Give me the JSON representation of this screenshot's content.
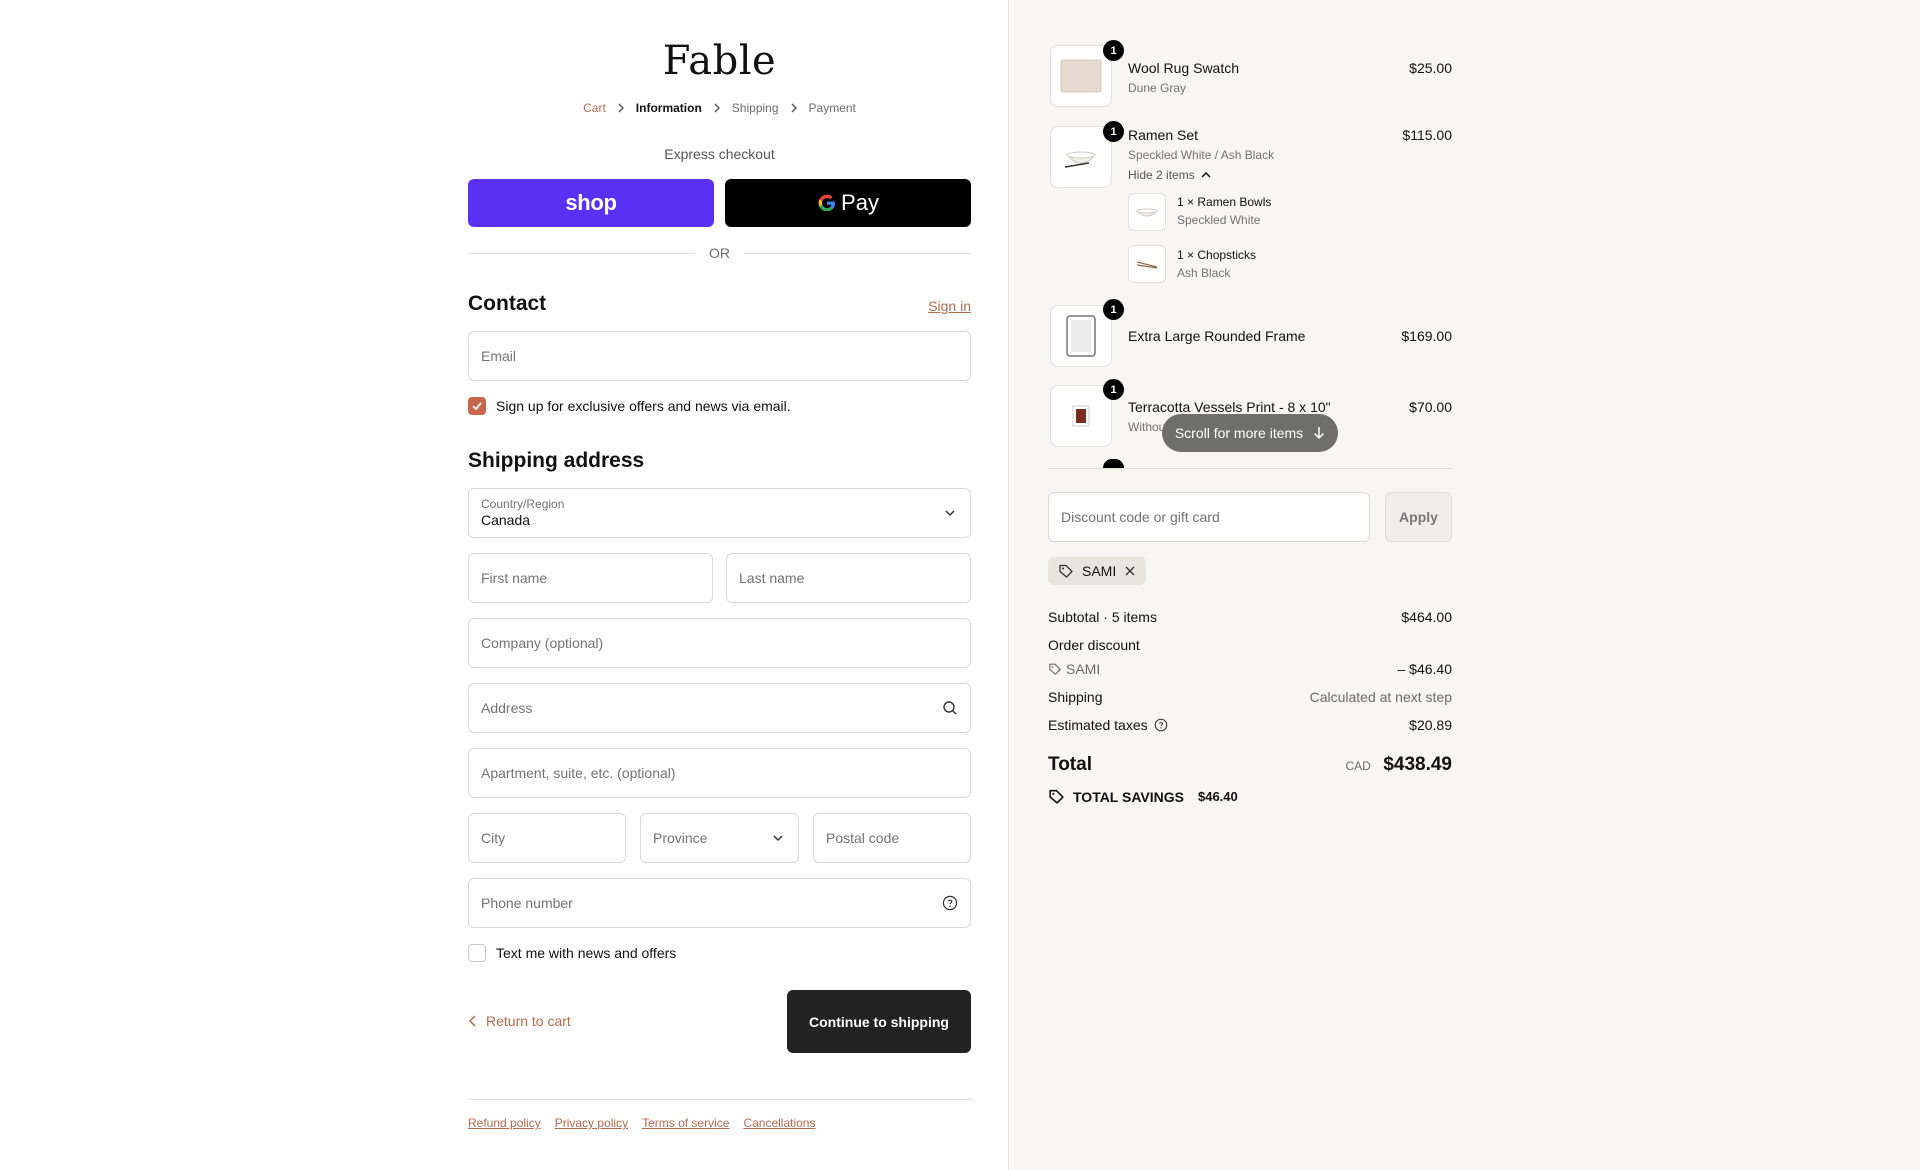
{
  "brand": {
    "logo": "Fable"
  },
  "breadcrumbs": [
    {
      "label": "Cart",
      "state": "link"
    },
    {
      "label": "Information",
      "state": "active"
    },
    {
      "label": "Shipping",
      "state": "pending"
    },
    {
      "label": "Payment",
      "state": "pending"
    }
  ],
  "express": {
    "label": "Express checkout",
    "shop_label": "shop",
    "gpay_label": "Pay",
    "or_label": "OR"
  },
  "contact": {
    "title": "Contact",
    "sign_in": "Sign in",
    "email_placeholder": "Email",
    "newsletter_label": "Sign up for exclusive offers and news via email.",
    "newsletter_checked": true
  },
  "shipping": {
    "title": "Shipping address",
    "country_label": "Country/Region",
    "country_value": "Canada",
    "first_name": "First name",
    "last_name": "Last name",
    "company": "Company (optional)",
    "address": "Address",
    "apartment": "Apartment, suite, etc. (optional)",
    "city": "City",
    "province": "Province",
    "postal": "Postal code",
    "phone": "Phone number",
    "sms_label": "Text me with news and offers",
    "sms_checked": false
  },
  "actions": {
    "return_label": "Return to cart",
    "continue_label": "Continue to shipping"
  },
  "footer": {
    "links": [
      "Refund policy",
      "Privacy policy",
      "Terms of service",
      "Cancellations"
    ]
  },
  "cart": {
    "items": [
      {
        "name": "Wool Rug Swatch",
        "variant": "Dune Gray",
        "price": "$25.00",
        "qty": "1"
      },
      {
        "name": "Ramen Set",
        "variant": "Speckled White / Ash Black",
        "price": "$115.00",
        "qty": "1",
        "toggle": "Hide 2 items",
        "sub": [
          {
            "name": "1 × Ramen Bowls",
            "variant": "Speckled White"
          },
          {
            "name": "1 × Chopsticks",
            "variant": "Ash Black"
          }
        ]
      },
      {
        "name": "Extra Large Rounded Frame",
        "variant": "",
        "price": "$169.00",
        "qty": "1"
      },
      {
        "name": "Terracotta Vessels Print - 8 x 10\"",
        "variant": "Withou",
        "price": "$70.00",
        "qty": "1"
      }
    ],
    "scroll_hint": "Scroll for more items"
  },
  "discount": {
    "placeholder": "Discount code or gift card",
    "apply_label": "Apply",
    "applied_code": "SAMI"
  },
  "summary": {
    "subtotal_label": "Subtotal · 5 items",
    "subtotal_value": "$464.00",
    "order_discount_label": "Order discount",
    "discount_code": "SAMI",
    "discount_value": "– $46.40",
    "shipping_label": "Shipping",
    "shipping_value": "Calculated at next step",
    "taxes_label": "Estimated taxes",
    "taxes_value": "$20.89",
    "total_label": "Total",
    "currency": "CAD",
    "total_value": "$438.49",
    "savings_label": "TOTAL SAVINGS",
    "savings_value": "$46.40"
  },
  "colors": {
    "accent": "#b56a4c",
    "shop_purple": "#5a31f4",
    "checkbox": "#c7664b",
    "dark_button": "#222222",
    "summary_bg": "#f7f6f3"
  }
}
